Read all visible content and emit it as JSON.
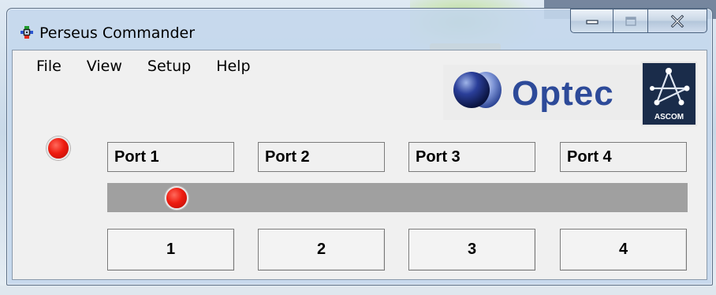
{
  "window": {
    "title": "Perseus Commander",
    "caption_buttons": [
      "minimize-icon",
      "maximize-icon",
      "close-icon"
    ]
  },
  "menu": {
    "items": [
      {
        "label": "File"
      },
      {
        "label": "View"
      },
      {
        "label": "Setup"
      },
      {
        "label": "Help"
      }
    ]
  },
  "branding": {
    "optec_text": "Optec",
    "ascom_text": "ASCOM"
  },
  "status": {
    "indicator_color": "#e8180e"
  },
  "ports": {
    "labels": [
      "Port 1",
      "Port 2",
      "Port 3",
      "Port 4"
    ],
    "buttons": [
      "1",
      "2",
      "3",
      "4"
    ],
    "selected_port": 1
  },
  "colors": {
    "led_red": "#e8180e",
    "optec_blue": "#2d4a99",
    "ascom_navy": "#1a2c4a",
    "slider_gray": "#a0a0a0"
  }
}
